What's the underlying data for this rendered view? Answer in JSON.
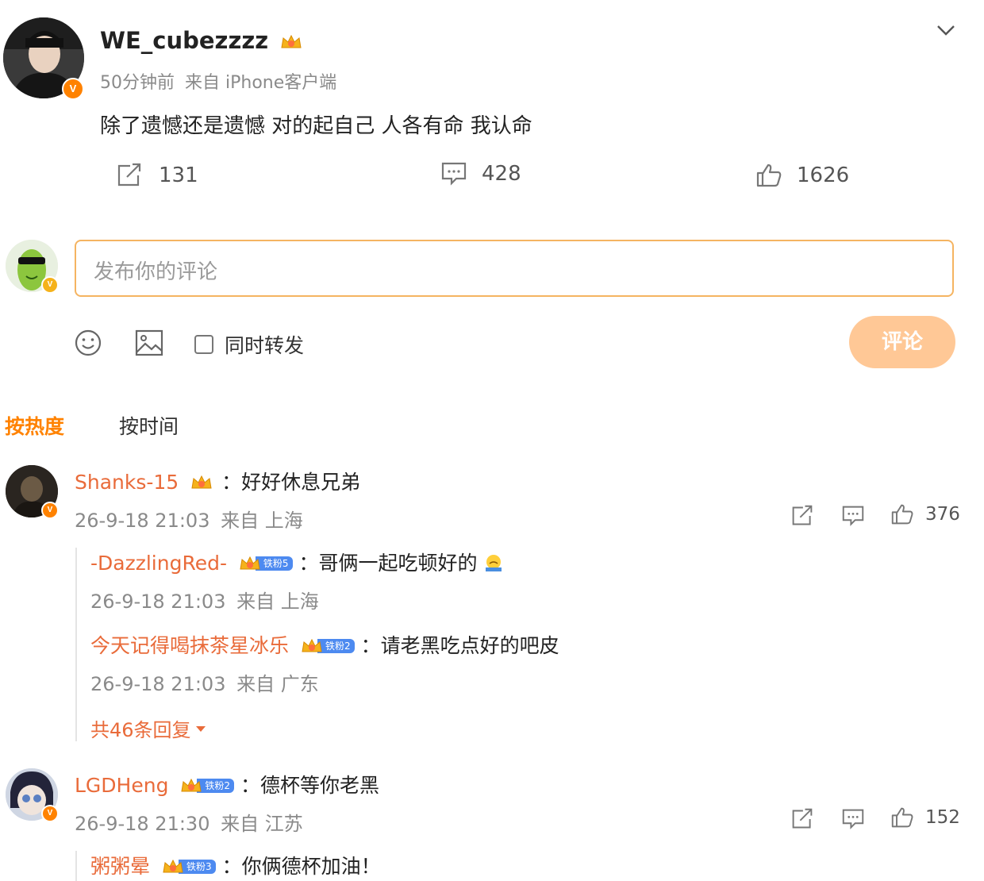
{
  "post": {
    "username": "WE_cubezzzz",
    "time": "50分钟前",
    "source": "来自 iPhone客户端",
    "content": "除了遗憾还是遗憾 对的起自己 人各有命 我认命",
    "reposts": "131",
    "comments": "428",
    "likes": "1626"
  },
  "composer": {
    "placeholder": "发布你的评论",
    "also_repost_label": "同时转发",
    "submit_label": "评论"
  },
  "sort_tabs": {
    "hot": "按热度",
    "time": "按时间"
  },
  "comments": [
    {
      "username": "Shanks-15",
      "text": "：好好休息兄弟",
      "time": "26-9-18 21:03",
      "location": "来自 上海",
      "likes": "376",
      "replies": [
        {
          "username": "-DazzlingRed-",
          "fan_badge": "铁粉5",
          "text": "：哥俩一起吃顿好的",
          "time": "26-9-18 21:03",
          "location": "来自 上海"
        },
        {
          "username": "今天记得喝抹茶星冰乐",
          "fan_badge": "铁粉2",
          "text": "：请老黑吃点好的吧皮",
          "time": "26-9-18 21:03",
          "location": "来自 广东"
        }
      ],
      "more_replies": "共46条回复"
    },
    {
      "username": "LGDHeng",
      "fan_badge": "铁粉2",
      "text": "：德杯等你老黑",
      "time": "26-9-18 21:30",
      "location": "来自 江苏",
      "likes": "152",
      "replies": [
        {
          "username": "粥粥晕",
          "fan_badge": "铁粉3",
          "text": "：你俩德杯加油！"
        }
      ]
    }
  ],
  "colors": {
    "accent": "#ff8200",
    "name": "#e96b3a",
    "meta": "#8a8a8a",
    "fan_badge": "#4d8af0",
    "button_disabled": "#ffc896"
  },
  "icons": [
    "chevron-down-icon",
    "repost-icon",
    "comment-icon",
    "like-icon",
    "emoji-icon",
    "image-icon",
    "checkbox-icon",
    "crown-icon",
    "caret-down-icon"
  ]
}
